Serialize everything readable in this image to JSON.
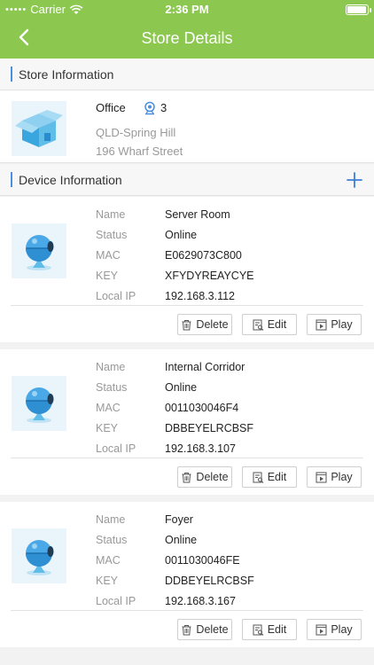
{
  "status_bar": {
    "carrier": "Carrier",
    "time": "2:36 PM"
  },
  "nav": {
    "title": "Store Details"
  },
  "store_section": {
    "title": "Store Information"
  },
  "store": {
    "name": "Office",
    "device_count": "3",
    "address_line1": "QLD-Spring Hill",
    "address_line2": "196 Wharf Street"
  },
  "device_section": {
    "title": "Device Information"
  },
  "labels": {
    "name": "Name",
    "status": "Status",
    "mac": "MAC",
    "key": "KEY",
    "local_ip": "Local IP"
  },
  "buttons": {
    "delete": "Delete",
    "edit": "Edit",
    "play": "Play"
  },
  "devices": [
    {
      "name": "Server Room",
      "status": "Online",
      "mac": "E0629073C800",
      "key": "XFYDYREAYCYE",
      "local_ip": "192.168.3.112"
    },
    {
      "name": "Internal Corridor",
      "status": "Online",
      "mac": "0011030046F4",
      "key": "DBBEYELRCBSF",
      "local_ip": "192.168.3.107"
    },
    {
      "name": "Foyer",
      "status": "Online",
      "mac": "0011030046FE",
      "key": "DDBEYELRCBSF",
      "local_ip": "192.168.3.167"
    }
  ],
  "colors": {
    "header": "#8cc850",
    "accent": "#4a8fe0",
    "muted_text": "#999999"
  },
  "icons": {
    "back": "chevron-left-icon",
    "add": "plus-icon",
    "store": "store-box-icon",
    "camera": "camera-icon",
    "delete": "trash-icon",
    "edit": "edit-icon",
    "play": "play-icon"
  }
}
